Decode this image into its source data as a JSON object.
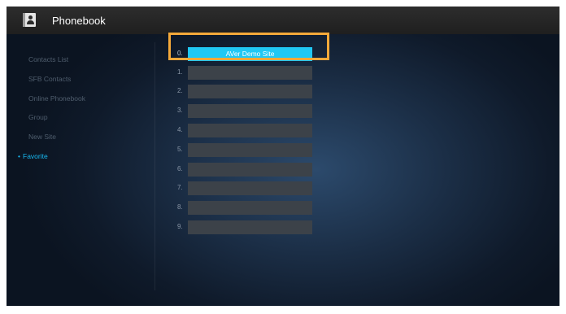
{
  "app": {
    "title": "Phonebook"
  },
  "sidebar": {
    "items": [
      {
        "label": "Contacts List",
        "active": false
      },
      {
        "label": "SFB Contacts",
        "active": false
      },
      {
        "label": "Online Phonebook",
        "active": false
      },
      {
        "label": "Group",
        "active": false
      },
      {
        "label": "New Site",
        "active": false
      },
      {
        "label": "Favorite",
        "active": true
      }
    ],
    "active_bullet": "•"
  },
  "favorites": [
    {
      "number": "0.",
      "name": "AVer Demo Site",
      "selected": true
    },
    {
      "number": "1.",
      "name": ""
    },
    {
      "number": "2.",
      "name": ""
    },
    {
      "number": "3.",
      "name": ""
    },
    {
      "number": "4.",
      "name": ""
    },
    {
      "number": "5.",
      "name": ""
    },
    {
      "number": "6.",
      "name": ""
    },
    {
      "number": "7.",
      "name": ""
    },
    {
      "number": "8.",
      "name": ""
    },
    {
      "number": "9.",
      "name": ""
    }
  ],
  "colors": {
    "accent": "#17b8f0",
    "selected_slot": "#20c8f4",
    "focus_ring": "#f4a93a",
    "empty_slot": "#3c4249"
  },
  "icons": {
    "app_icon": "phonebook-icon"
  }
}
